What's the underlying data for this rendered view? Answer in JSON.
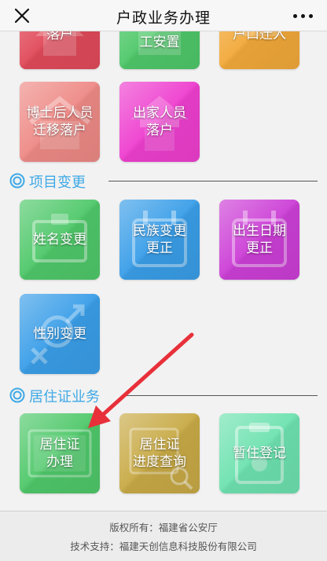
{
  "header": {
    "title": "户政业务办理"
  },
  "sections": {
    "project_change": "项目变更",
    "residence_permit": "居住证业务"
  },
  "tiles": {
    "top_partial_1": "落户",
    "top_partial_2": "工安置",
    "top_partial_3": "户口迁入",
    "postdoc": "博士后人员\n迁移落户",
    "monk": "出家人员\n落户",
    "name_change": "姓名变更",
    "ethnic_change": "民族变更\n更正",
    "birthdate": "出生日期\n更正",
    "gender_change": "性别变更",
    "permit_apply": "居住证\n办理",
    "permit_query": "居住证\n进度查询",
    "temp_reg": "暂住登记"
  },
  "colors": {
    "accent": "#3fa9e6",
    "arrow": "#e8303a",
    "red": "#e14a5a",
    "green": "#4fc86a",
    "orange": "#f2a93a",
    "salmon": "#ee8a86",
    "magenta": "#ee3fcf",
    "purple": "#cc3fd6",
    "blue": "#3a9ee8",
    "gold": "#c8aa46",
    "mint": "#6ee2b0"
  },
  "footer": {
    "copyright": "版权所有：福建省公安厅",
    "support": "技术支持：福建天创信息科技股份有限公司"
  }
}
